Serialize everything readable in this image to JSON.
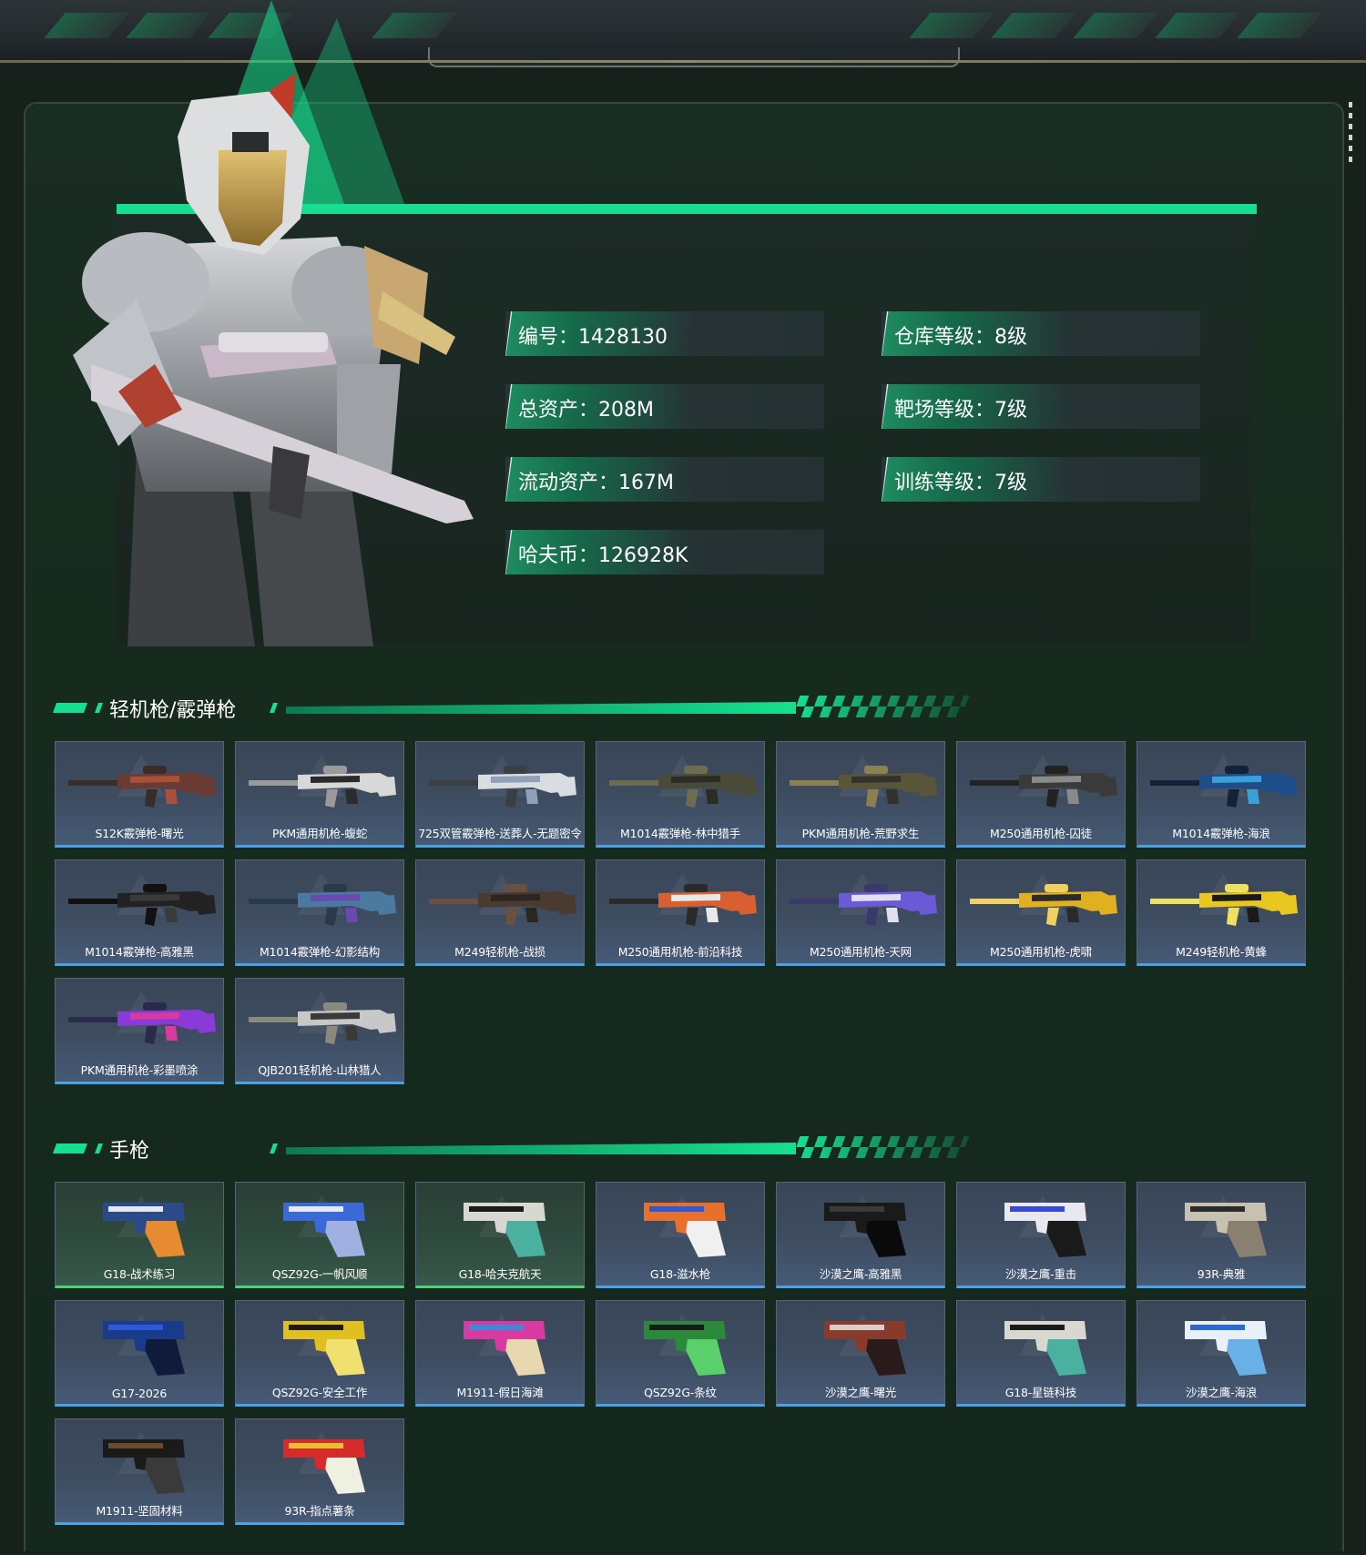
{
  "colors": {
    "accent": "#16e08f",
    "rarity_blue": "#4aa3e8",
    "rarity_green": "#4fd07a",
    "panel": "#1d2b26"
  },
  "profile": {
    "id_label": "编号：1428130",
    "total_assets_label": "总资产：208M",
    "liquid_assets_label": "流动资产：167M",
    "coins_label": "哈夫币：126928K",
    "warehouse_level_label": "仓库等级：8级",
    "range_level_label": "靶场等级：7级",
    "training_level_label": "训练等级：7级"
  },
  "sections": {
    "lmg_title": "轻机枪/霰弹枪",
    "pistol_title": "手枪"
  },
  "lmg": [
    {
      "name": "S12K霰弹枪-曙光",
      "rarity": "blue",
      "palette": [
        "#6b3a30",
        "#a8503a",
        "#3a2c2a"
      ]
    },
    {
      "name": "PKM通用机枪-蝮蛇",
      "rarity": "blue",
      "palette": [
        "#d8d8d8",
        "#2b2b2b",
        "#9a9a9a"
      ]
    },
    {
      "name": "725双管霰弹枪-送葬人-无题密令",
      "rarity": "blue",
      "palette": [
        "#d9dde2",
        "#8fa0b8",
        "#3a3f46"
      ]
    },
    {
      "name": "M1014霰弹枪-林中猎手",
      "rarity": "blue",
      "palette": [
        "#4a4a38",
        "#2c2c24",
        "#6c6c50"
      ]
    },
    {
      "name": "PKM通用机枪-荒野求生",
      "rarity": "blue",
      "palette": [
        "#5a5538",
        "#33322a",
        "#8a8050"
      ]
    },
    {
      "name": "M250通用机枪-囚徒",
      "rarity": "blue",
      "palette": [
        "#3a3a3a",
        "#8a8a8a",
        "#222222"
      ]
    },
    {
      "name": "M1014霰弹枪-海浪",
      "rarity": "blue",
      "palette": [
        "#1d4e8a",
        "#3aa0d8",
        "#13223a"
      ]
    },
    {
      "name": "M1014霰弹枪-高雅黑",
      "rarity": "blue",
      "palette": [
        "#222222",
        "#3a3a3a",
        "#111111"
      ]
    },
    {
      "name": "M1014霰弹枪-幻影结构",
      "rarity": "blue",
      "palette": [
        "#4a7aa0",
        "#6a4ab0",
        "#2a3a4a"
      ]
    },
    {
      "name": "M249轻机枪-战损",
      "rarity": "blue",
      "palette": [
        "#4a3a30",
        "#2c2520",
        "#6a5040"
      ]
    },
    {
      "name": "M250通用机枪-前沿科技",
      "rarity": "blue",
      "palette": [
        "#d86030",
        "#e8e8e8",
        "#2a2a2a"
      ]
    },
    {
      "name": "M250通用机枪-天网",
      "rarity": "blue",
      "palette": [
        "#6a5ad8",
        "#e0e0f0",
        "#3a3a6a"
      ]
    },
    {
      "name": "M250通用机枪-虎啸",
      "rarity": "blue",
      "palette": [
        "#e0b020",
        "#2a2a2a",
        "#f0d060"
      ]
    },
    {
      "name": "M249轻机枪-黄蜂",
      "rarity": "blue",
      "palette": [
        "#e8c820",
        "#1a1a1a",
        "#f0e060"
      ]
    },
    {
      "name": "PKM通用机枪-彩墨喷涂",
      "rarity": "blue",
      "palette": [
        "#8a3ad8",
        "#d83aa0",
        "#2a2a4a"
      ]
    },
    {
      "name": "QJB201轻机枪-山林猎人",
      "rarity": "blue",
      "palette": [
        "#c8c8c8",
        "#3a3a3a",
        "#8a8a7a"
      ]
    }
  ],
  "pistols": [
    {
      "name": "G18-战术练习",
      "rarity": "green",
      "palette": [
        "#2a4a8a",
        "#e8e8e8",
        "#e88a30"
      ]
    },
    {
      "name": "QSZ92G-一帆风顺",
      "rarity": "green",
      "palette": [
        "#3a6ad8",
        "#e8e8f0",
        "#a0b0e0"
      ]
    },
    {
      "name": "G18-哈夫克航天",
      "rarity": "green",
      "palette": [
        "#d8d8d0",
        "#1a1a1a",
        "#4ab0a0"
      ]
    },
    {
      "name": "G18-滋水枪",
      "rarity": "blue",
      "palette": [
        "#e8702a",
        "#2a5ad8",
        "#f0f0f0"
      ]
    },
    {
      "name": "沙漠之鹰-高雅黑",
      "rarity": "blue",
      "palette": [
        "#1a1a1a",
        "#3a3a3a",
        "#0a0a0a"
      ]
    },
    {
      "name": "沙漠之鹰-重击",
      "rarity": "blue",
      "palette": [
        "#e8e8f0",
        "#3a4ad8",
        "#1a1a1a"
      ]
    },
    {
      "name": "93R-典雅",
      "rarity": "blue",
      "palette": [
        "#c8c0b0",
        "#2a2a2a",
        "#8a8070"
      ]
    },
    {
      "name": "G17-2026",
      "rarity": "blue",
      "palette": [
        "#1a3a8a",
        "#2a5ad8",
        "#101a3a"
      ]
    },
    {
      "name": "QSZ92G-安全工作",
      "rarity": "blue",
      "palette": [
        "#e0c020",
        "#1a1a1a",
        "#f0e070"
      ]
    },
    {
      "name": "M1911-假日海滩",
      "rarity": "blue",
      "palette": [
        "#d83aa0",
        "#3a8ad8",
        "#e8d8b0"
      ]
    },
    {
      "name": "QSZ92G-条纹",
      "rarity": "blue",
      "palette": [
        "#2a8a3a",
        "#1a1a1a",
        "#5ad06a"
      ]
    },
    {
      "name": "沙漠之鹰-曙光",
      "rarity": "blue",
      "palette": [
        "#8a3a2a",
        "#d8d0c8",
        "#2a1a1a"
      ]
    },
    {
      "name": "G18-星链科技",
      "rarity": "blue",
      "palette": [
        "#d8d8d0",
        "#1a1a1a",
        "#4ab0a0"
      ]
    },
    {
      "name": "沙漠之鹰-海浪",
      "rarity": "blue",
      "palette": [
        "#e8f0f8",
        "#2a6ad8",
        "#6ab0e8"
      ]
    },
    {
      "name": "M1911-坚固材料",
      "rarity": "blue",
      "palette": [
        "#1a1a1a",
        "#6a4a2a",
        "#3a3a3a"
      ]
    },
    {
      "name": "93R-指点薯条",
      "rarity": "blue",
      "palette": [
        "#d82a2a",
        "#e8c030",
        "#f0f0e0"
      ]
    }
  ]
}
